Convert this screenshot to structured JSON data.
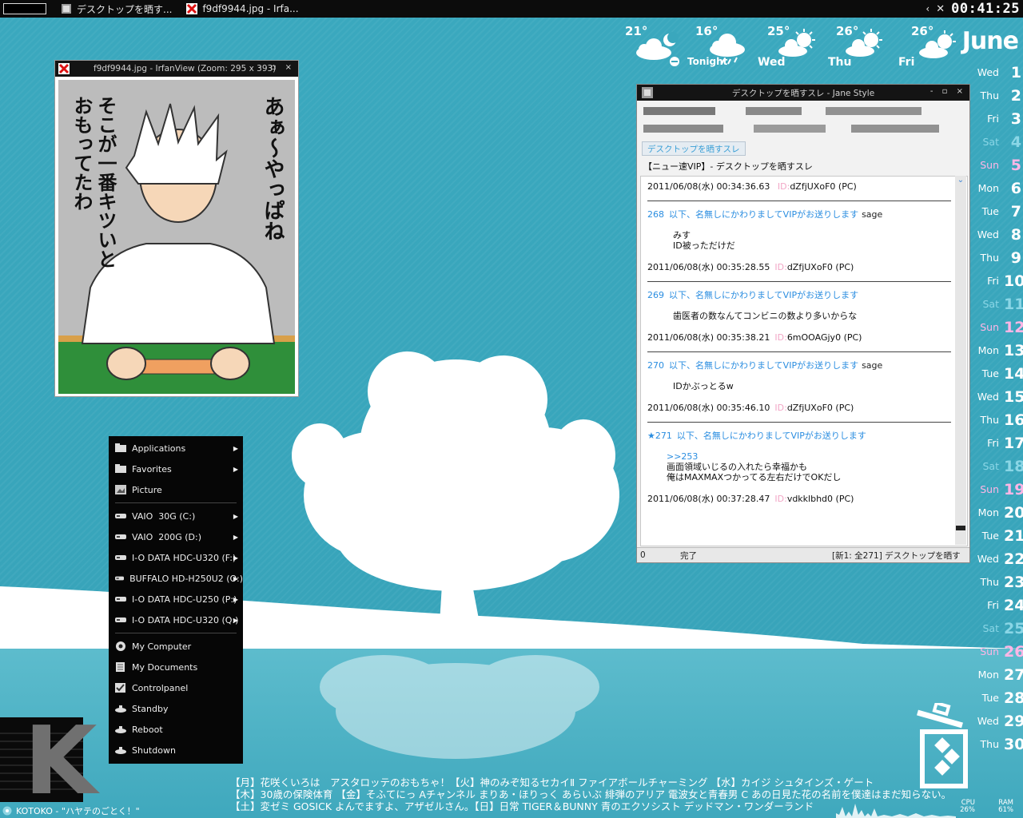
{
  "taskbar": {
    "tasks": [
      {
        "label": "デスクトップを晒す..."
      },
      {
        "label": "f9df9944.jpg - Irfa..."
      }
    ],
    "clock": "00:41:25",
    "controls": {
      "back": "‹",
      "close": "✕"
    }
  },
  "weather": [
    {
      "temp": "21°",
      "label": "",
      "icon": "cloud-moon-icon"
    },
    {
      "temp": "16°",
      "label": "Tonight",
      "icon": "cloud-rain-icon"
    },
    {
      "temp": "25°",
      "label": "Wed",
      "icon": "sun-cloud-icon"
    },
    {
      "temp": "26°",
      "label": "Thu",
      "icon": "sun-cloud-icon"
    },
    {
      "temp": "26°",
      "label": "Fri",
      "icon": "sun-cloud-icon"
    }
  ],
  "calendar": {
    "month": "June",
    "days": [
      {
        "dw": "Wed",
        "dn": "1",
        "kind": "wk"
      },
      {
        "dw": "Thu",
        "dn": "2",
        "kind": "wk"
      },
      {
        "dw": "Fri",
        "dn": "3",
        "kind": "wk"
      },
      {
        "dw": "Sat",
        "dn": "4",
        "kind": "sat"
      },
      {
        "dw": "Sun",
        "dn": "5",
        "kind": "sun"
      },
      {
        "dw": "Mon",
        "dn": "6",
        "kind": "wk"
      },
      {
        "dw": "Tue",
        "dn": "7",
        "kind": "wk"
      },
      {
        "dw": "Wed",
        "dn": "8",
        "kind": "wk"
      },
      {
        "dw": "Thu",
        "dn": "9",
        "kind": "wk"
      },
      {
        "dw": "Fri",
        "dn": "10",
        "kind": "wk"
      },
      {
        "dw": "Sat",
        "dn": "11",
        "kind": "sat"
      },
      {
        "dw": "Sun",
        "dn": "12",
        "kind": "sun"
      },
      {
        "dw": "Mon",
        "dn": "13",
        "kind": "wk"
      },
      {
        "dw": "Tue",
        "dn": "14",
        "kind": "wk"
      },
      {
        "dw": "Wed",
        "dn": "15",
        "kind": "wk"
      },
      {
        "dw": "Thu",
        "dn": "16",
        "kind": "wk"
      },
      {
        "dw": "Fri",
        "dn": "17",
        "kind": "wk"
      },
      {
        "dw": "Sat",
        "dn": "18",
        "kind": "sat"
      },
      {
        "dw": "Sun",
        "dn": "19",
        "kind": "sun"
      },
      {
        "dw": "Mon",
        "dn": "20",
        "kind": "wk"
      },
      {
        "dw": "Tue",
        "dn": "21",
        "kind": "wk"
      },
      {
        "dw": "Wed",
        "dn": "22",
        "kind": "wk"
      },
      {
        "dw": "Thu",
        "dn": "23",
        "kind": "wk"
      },
      {
        "dw": "Fri",
        "dn": "24",
        "kind": "wk"
      },
      {
        "dw": "Sat",
        "dn": "25",
        "kind": "sat"
      },
      {
        "dw": "Sun",
        "dn": "26",
        "kind": "sun"
      },
      {
        "dw": "Mon",
        "dn": "27",
        "kind": "wk"
      },
      {
        "dw": "Tue",
        "dn": "28",
        "kind": "wk"
      },
      {
        "dw": "Wed",
        "dn": "29",
        "kind": "wk"
      },
      {
        "dw": "Thu",
        "dn": "30",
        "kind": "wk"
      }
    ]
  },
  "irfanview": {
    "title": "f9df9944.jpg - IrfanView (Zoom: 295 x 393)",
    "controls": "- ▫ ×",
    "text_right": "あぁ〜やっぱね",
    "text_left_1": "そこが一番キツいと",
    "text_left_2": "おもってたわ"
  },
  "jane": {
    "title": "デスクトップを晒すスレ - Jane Style",
    "controls": "- ▫ ×",
    "tab": "デスクトップを晒すスレ",
    "thread_title": "【ニュー速VIP】- デスクトップを晒すスレ",
    "first_date": "2011/06/08(水) 00:34:36.63",
    "first_id": "dZfjUXoF0 (PC)",
    "posts": [
      {
        "num": "268",
        "name": "以下、名無しにかわりましてVIPがお送りします",
        "mail": "sage",
        "lines": [
          "みす",
          "ID被っただけだ"
        ],
        "date": "2011/06/08(水) 00:35:28.55",
        "id": "dZfjUXoF0 (PC)"
      },
      {
        "num": "269",
        "name": "以下、名無しにかわりましてVIPがお送りします",
        "mail": "",
        "lines": [
          "歯医者の数なんてコンビニの数より多いからな"
        ],
        "date": "2011/06/08(水) 00:35:38.21",
        "id": "6mOOAGjy0 (PC)"
      },
      {
        "num": "270",
        "name": "以下、名無しにかわりましてVIPがお送りします",
        "mail": "sage",
        "lines": [
          "IDかぶっとるw"
        ],
        "date": "2011/06/08(水) 00:35:46.10",
        "id": "dZfjUXoF0 (PC)"
      },
      {
        "num": "★271",
        "name": "以下、名無しにかわりましてVIPがお送りします",
        "mail": "",
        "anchor": ">>253",
        "lines": [
          "画面領域いじるの入れたら幸福かも",
          "俺はMAXMAXつかってる左右だけでOKだし"
        ],
        "date": "2011/06/08(水) 00:37:28.47",
        "id": "vdkklbhd0 (PC)"
      }
    ],
    "id_label": "ID:",
    "status": {
      "count": "0",
      "state": "完了",
      "info": "[新1: 全271] デスクトップを晒す"
    }
  },
  "menu": {
    "items": [
      {
        "label": "Applications",
        "icon": "folder-icon",
        "arrow": true
      },
      {
        "label": "Favorites",
        "icon": "folder-icon",
        "arrow": true
      },
      {
        "label": "Picture",
        "icon": "picture-icon",
        "arrow": false
      },
      {
        "label": "VAIO  30G (C:)",
        "icon": "drive-icon",
        "arrow": true
      },
      {
        "label": "VAIO  200G (D:)",
        "icon": "drive-icon",
        "arrow": true
      },
      {
        "label": "I-O DATA HDC-U320 (F:)",
        "icon": "drive-icon",
        "arrow": true
      },
      {
        "label": "BUFFALO HD-H250U2 (O:)",
        "icon": "drive-icon",
        "arrow": true
      },
      {
        "label": "I-O DATA HDC-U250 (P:)",
        "icon": "drive-icon",
        "arrow": true
      },
      {
        "label": "I-O DATA HDC-U320 (Q:)",
        "icon": "drive-icon",
        "arrow": true
      },
      {
        "label": "My Computer",
        "icon": "computer-icon",
        "arrow": false
      },
      {
        "label": "My Documents",
        "icon": "documents-icon",
        "arrow": false
      },
      {
        "label": "Controlpanel",
        "icon": "controlpanel-icon",
        "arrow": false
      },
      {
        "label": "Standby",
        "icon": "standby-icon",
        "arrow": false
      },
      {
        "label": "Reboot",
        "icon": "reboot-icon",
        "arrow": false
      },
      {
        "label": "Shutdown",
        "icon": "shutdown-icon",
        "arrow": false
      }
    ],
    "arrow_glyph": "▶"
  },
  "bottom": {
    "k_letter": "K",
    "nowplaying": "KOTOKO - \"ハヤテのごとく！\"",
    "ticker": [
      "【月】花咲くいろは　アスタロッテのおもちゃ！【火】神のみぞ知るセカイⅡ ファイアボールチャーミング 【水】カイジ シュタインズ・ゲート",
      "【木】30歳の保険体育 【金】そふてにっ Aチャンネル まりあ・ほりっく あらいぶ 緋弾のアリア 電波女と青春男 C あの日見た花の名前を僕達はまだ知らない。",
      "【土】変ゼミ GOSICK よんでますよ、アザゼルさん。【日】日常 TIGER＆BUNNY 青のエクソシスト デッドマン・ワンダーランド"
    ],
    "cpu_label": "CPU",
    "cpu_value": "26%",
    "ram_label": "RAM",
    "ram_value": "61%"
  }
}
